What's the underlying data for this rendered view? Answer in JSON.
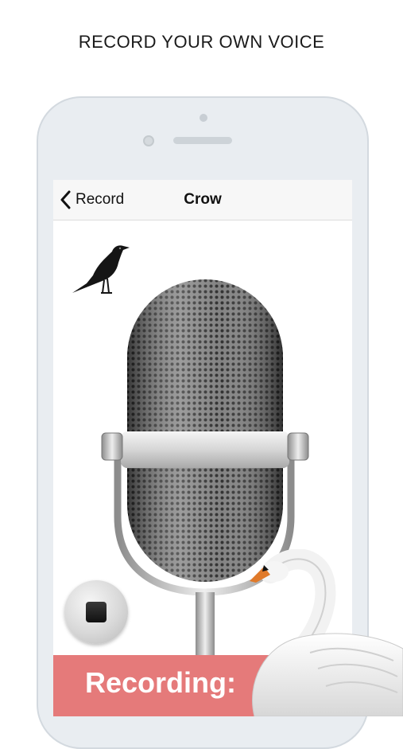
{
  "headline": "RECORD YOUR OWN VOICE",
  "navbar": {
    "back_label": "Record",
    "title": "Crow"
  },
  "status": {
    "recording_label": "Recording:"
  },
  "icons": {
    "back": "chevron-left-icon",
    "stop": "stop-icon",
    "microphone": "microphone-icon",
    "crow": "crow-icon",
    "swan": "swan-icon"
  },
  "colors": {
    "banner": "#e57a7a",
    "phone_body": "#e9edf1"
  }
}
